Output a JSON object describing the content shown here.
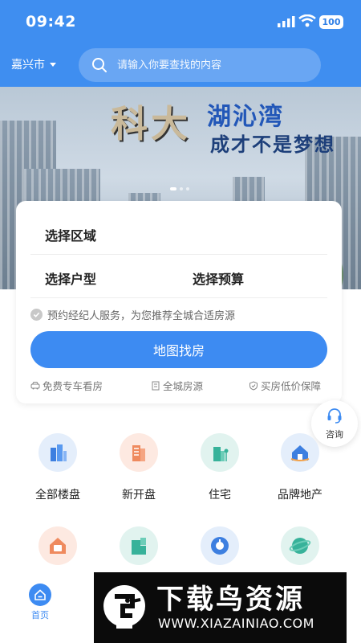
{
  "status_bar": {
    "time": "09:42",
    "battery": "100"
  },
  "header": {
    "city": "嘉兴市",
    "search_placeholder": "请输入你要查找的内容"
  },
  "banner": {
    "brand_mark": "科大",
    "project_name": "湖沁湾",
    "slogan": "成才不是梦想"
  },
  "filter_card": {
    "select_area": "选择区域",
    "select_layout": "选择户型",
    "select_budget": "选择预算",
    "agent_service": "预约经纪人服务，为您推荐全城合适房源",
    "map_search_button": "地图找房",
    "features": [
      "免费专车看房",
      "全城房源",
      "买房低价保障"
    ]
  },
  "consult": {
    "label": "咨询"
  },
  "categories": [
    {
      "label": "全部楼盘",
      "icon": "building-icon"
    },
    {
      "label": "新开盘",
      "icon": "new-building-icon"
    },
    {
      "label": "住宅",
      "icon": "residence-icon"
    },
    {
      "label": "品牌地产",
      "icon": "brand-estate-icon"
    },
    {
      "label": "",
      "icon": "rent-icon"
    },
    {
      "label": "",
      "icon": "office-icon"
    },
    {
      "label": "",
      "icon": "compass-icon"
    },
    {
      "label": "",
      "icon": "planet-icon"
    }
  ],
  "tabbar": {
    "home_label": "首页"
  },
  "watermark": {
    "title": "下载鸟资源",
    "url": "WWW.XIAZAINIAO.COM"
  },
  "colors": {
    "primary": "#3d8bf2",
    "header": "#3f8ef0"
  }
}
